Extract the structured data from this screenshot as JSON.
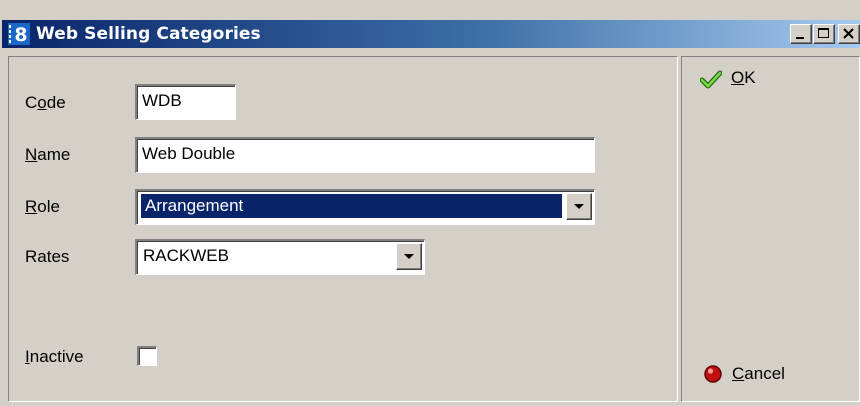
{
  "window": {
    "title": "Web Selling Categories",
    "icon_glyph": "8",
    "icon_name": "app-icon"
  },
  "caption_buttons": {
    "minimize": "minimize-icon",
    "maximize": "maximize-icon",
    "close": "close-icon"
  },
  "form": {
    "code": {
      "label_prefix": "C",
      "label_accel": "o",
      "label_suffix": "de",
      "value": "WDB"
    },
    "name": {
      "label_prefix": "",
      "label_accel": "N",
      "label_suffix": "ame",
      "value": "Web Double"
    },
    "role": {
      "label_prefix": "",
      "label_accel": "R",
      "label_suffix": "ole",
      "value": "Arrangement"
    },
    "rates": {
      "label": "Rates",
      "value": "RACKWEB"
    },
    "inactive": {
      "label_prefix": "",
      "label_accel": "I",
      "label_suffix": "nactive",
      "checked": false
    }
  },
  "buttons": {
    "ok": {
      "accel": "O",
      "rest": "K",
      "icon": "checkmark-icon"
    },
    "cancel": {
      "accel": "C",
      "rest": "ancel",
      "icon": "red-circle-icon"
    }
  },
  "colors": {
    "titlebar_start": "#0a246a",
    "titlebar_end": "#a6caf0",
    "selection": "#0a246a",
    "face": "#d4d0c8"
  }
}
